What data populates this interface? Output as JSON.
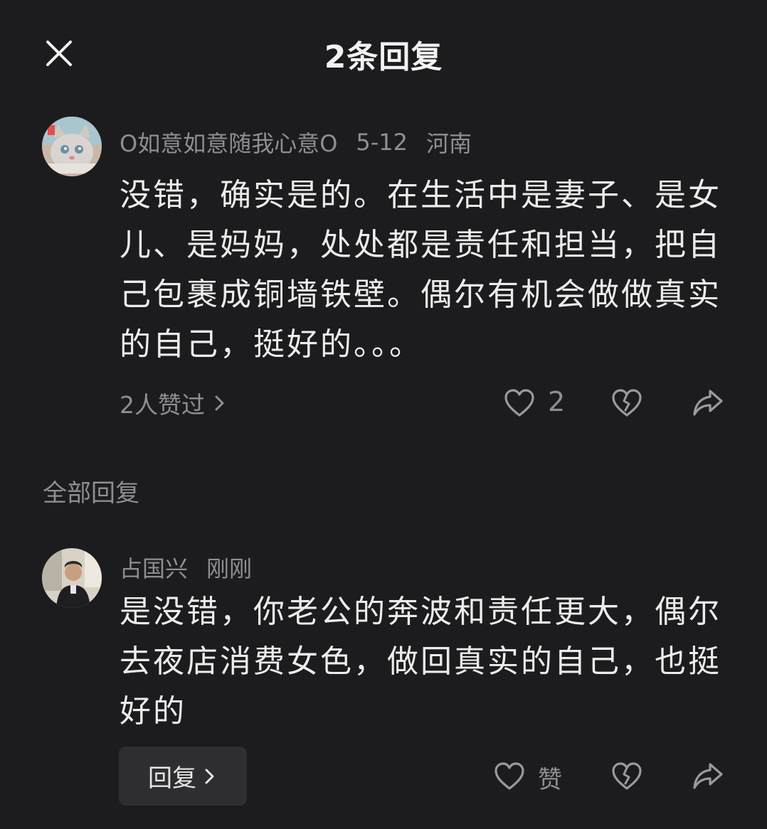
{
  "header": {
    "title": "2条回复"
  },
  "main_comment": {
    "username": "O如意如意随我心意O",
    "date": "5-12",
    "location": "河南",
    "text": "没错，确实是的。在生活中是妻子、是女儿、是妈妈，处处都是责任和担当，把自己包裹成铜墙铁壁。偶尔有机会做做真实的自己，挺好的。。。",
    "likers_label": "2人赞过",
    "like_count": "2",
    "avatar_icon": "cat-avatar"
  },
  "section": {
    "label": "全部回复"
  },
  "reply": {
    "username": "占国兴",
    "time": "刚刚",
    "text": "是没错，你老公的奔波和责任更大，偶尔去夜店消费女色，做回真实的自己，也挺好的",
    "reply_button_label": "回复",
    "like_label": "赞",
    "avatar_icon": "person-avatar"
  },
  "colors": {
    "background": "#1c1c1e",
    "primary_text": "#ececec",
    "secondary_text": "#8e8e93",
    "button_bg": "#2e2e30"
  }
}
